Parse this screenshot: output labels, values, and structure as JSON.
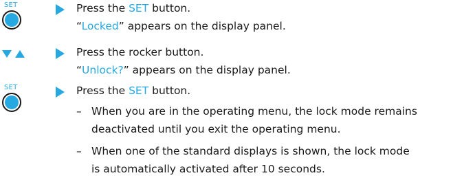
{
  "colors": {
    "accent": "#26a9e0",
    "text": "#1a1a1a"
  },
  "steps": [
    {
      "icon": "set-button-icon",
      "icon_label": "SET",
      "instruction": {
        "before": "Press the ",
        "highlight": "SET",
        "after": " button."
      },
      "result": {
        "open_quote": "“",
        "highlight": "Locked",
        "after": "” appears on the display panel."
      }
    },
    {
      "icon": "rocker-button-icon",
      "instruction": {
        "text": "Press the rocker button."
      },
      "result": {
        "open_quote": "“",
        "highlight": "Unlock?",
        "after": "” appears on the display panel."
      }
    },
    {
      "icon": "set-button-icon",
      "icon_label": "SET",
      "instruction": {
        "before": "Press the ",
        "highlight": "SET",
        "after": " button."
      },
      "dash": "–",
      "sub_items": [
        {
          "line1": "When you are in the operating menu, the lock mode remains",
          "line2": "deactivated until you exit the operating menu."
        },
        {
          "line1": "When one of the standard displays is shown, the lock mode",
          "line2": "is automatically activated after 10 seconds."
        }
      ]
    }
  ]
}
